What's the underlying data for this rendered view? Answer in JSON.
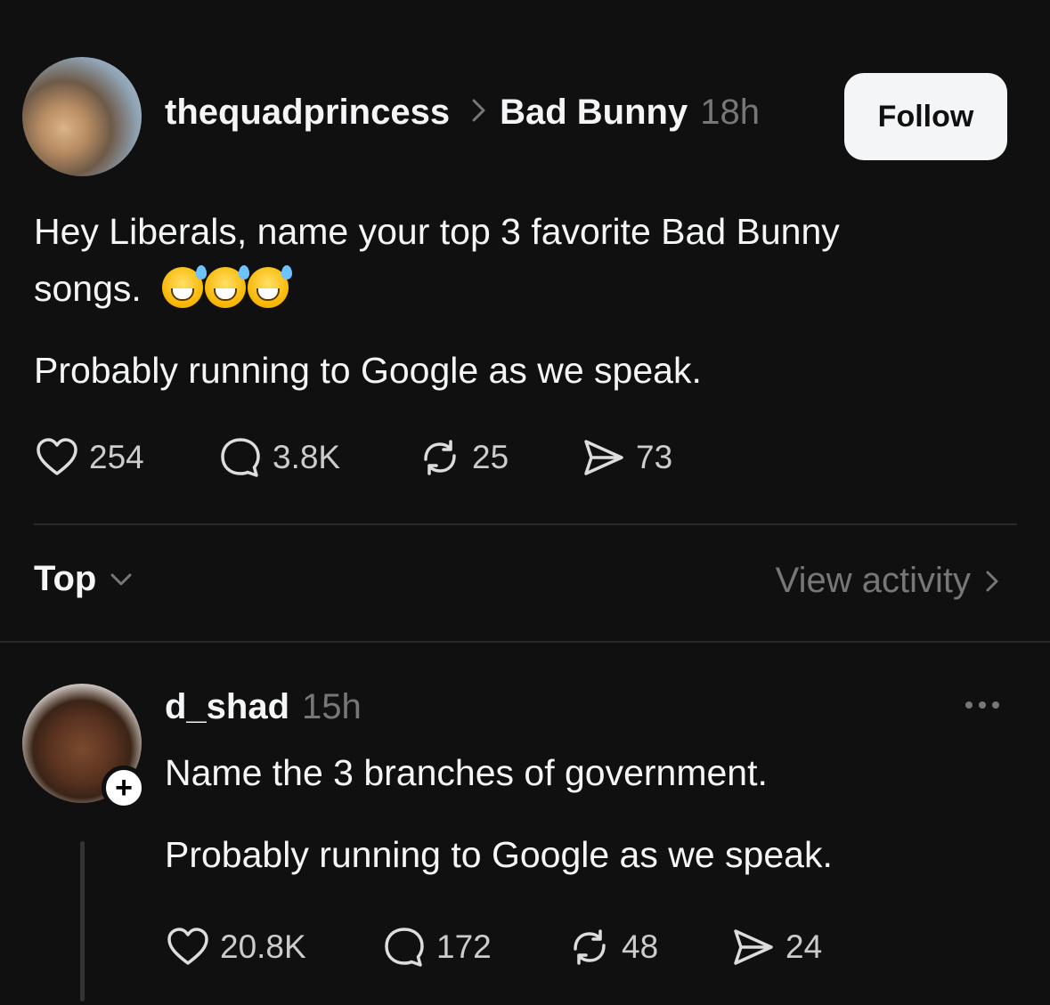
{
  "post": {
    "author": "thequadprincess",
    "topic": "Bad Bunny",
    "time": "18h",
    "follow_label": "Follow",
    "line1": "Hey Liberals, name your top 3 favorite Bad Bunny",
    "line2": "songs.",
    "line3": "Probably running to Google as we speak.",
    "emojis": [
      "grinning-sweat-emoji",
      "grinning-sweat-emoji",
      "grinning-sweat-emoji"
    ],
    "stats": {
      "likes": "254",
      "replies": "3.8K",
      "reposts": "25",
      "shares": "73"
    }
  },
  "sort": {
    "label": "Top",
    "view_activity": "View activity"
  },
  "reply": {
    "author": "d_shad",
    "time": "15h",
    "line1": "Name the 3 branches of government.",
    "line2": "Probably running to Google as we speak.",
    "stats": {
      "likes": "20.8K",
      "replies": "172",
      "reposts": "48",
      "shares": "24"
    }
  },
  "icons": {
    "separator": "chevron-right-icon",
    "like": "heart-icon",
    "reply": "comment-icon",
    "repost": "repost-icon",
    "share": "send-icon",
    "sort": "chevron-down-icon",
    "more": "more-icon",
    "follow_badge": "plus-icon"
  },
  "colors": {
    "background": "#101010",
    "text": "#f3f5f7",
    "muted": "#777777",
    "button_bg": "#f3f5f7"
  }
}
